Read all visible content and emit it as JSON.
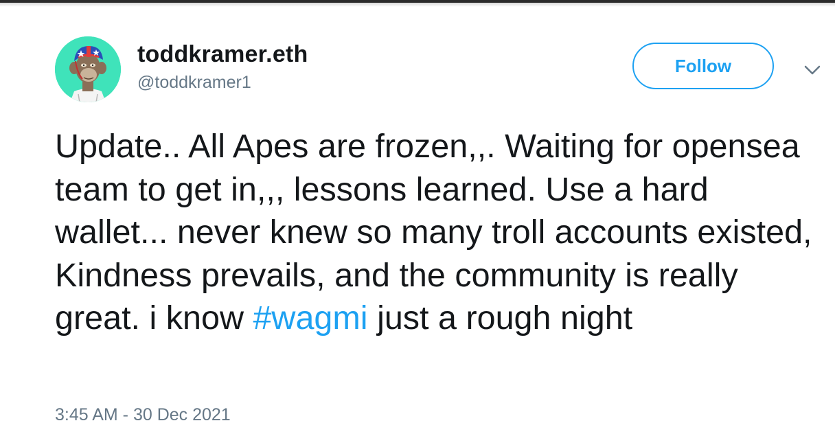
{
  "author": {
    "display_name": "toddkramer.eth",
    "handle": "@toddkramer1",
    "avatar_icon": "bored-ape-avatar-icon"
  },
  "actions": {
    "follow_label": "Follow",
    "more_icon": "chevron-down-icon"
  },
  "tweet": {
    "text_before_hashtag": "Update.. All Apes are frozen,,. Waiting for opensea team to get in,,, lessons learned. Use a hard wallet... never knew so many troll accounts existed, Kindness prevails, and the community is really great. i know",
    "hashtag": "#wagmi",
    "text_after_hashtag": "just a rough night",
    "timestamp": "3:45 AM - 30 Dec 2021"
  },
  "colors": {
    "accent": "#1da1f2",
    "text": "#14171a",
    "secondary_text": "#657786",
    "avatar_background": "#3fe3ba"
  }
}
